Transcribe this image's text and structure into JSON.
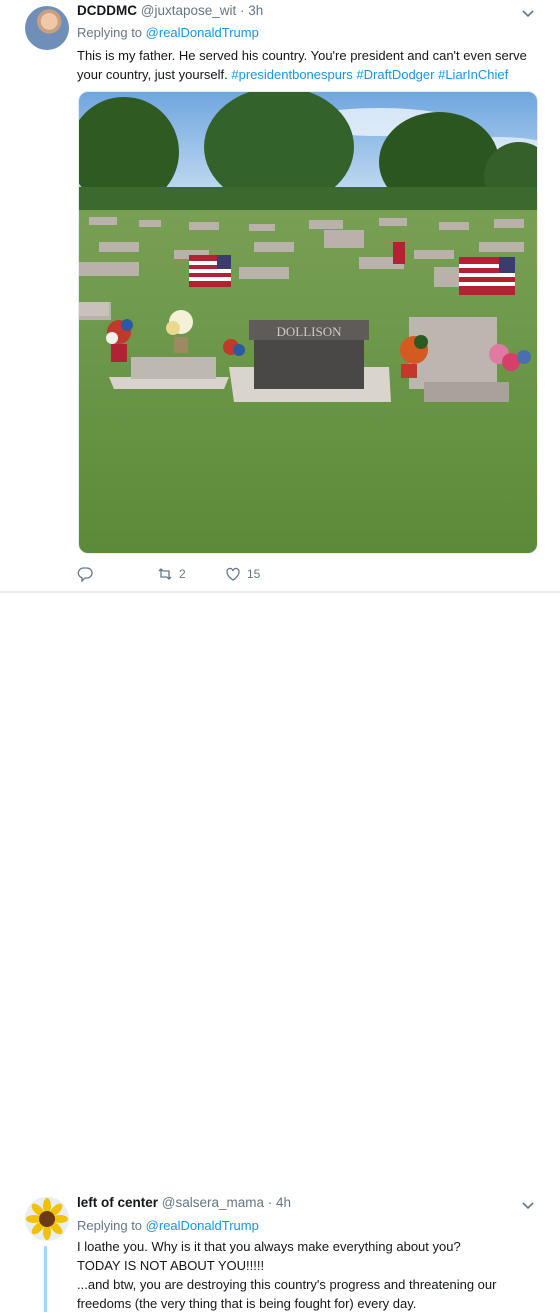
{
  "tweet1": {
    "name": "DCDDMC",
    "handle": "@juxtapose_wit",
    "time": "· 3h",
    "replying_prefix": "Replying to",
    "replying_to": "@realDonaldTrump",
    "text": "This is my father. He served his country. You're president and can't even serve your country, just yourself. ",
    "hashtags": [
      "#presidentbonespurs",
      "#DraftDodger",
      "#LiarInChief"
    ],
    "actions": {
      "replies": "",
      "retweets": "2",
      "likes": "15"
    },
    "photo_text": {
      "headstone": "DOLLISON"
    }
  },
  "tweet2": {
    "name": "left of center",
    "handle": "@salsera_mama",
    "time": "· 4h",
    "replying_prefix": "Replying to",
    "replying_to": "@realDonaldTrump",
    "lines": [
      "I loathe you. Why is it that you always make everything about you?",
      "TODAY IS NOT ABOUT YOU!!!!!",
      "...and btw, you are destroying this country's progress and threatening our freedoms (the very thing that is being fought for) every day."
    ]
  },
  "colors": {
    "link": "#1b95e0",
    "muted": "#657786",
    "text": "#14171a",
    "thread": "#a8d4ff"
  },
  "icons": [
    "chevron-down-icon",
    "reply-icon",
    "retweet-icon",
    "like-icon"
  ]
}
